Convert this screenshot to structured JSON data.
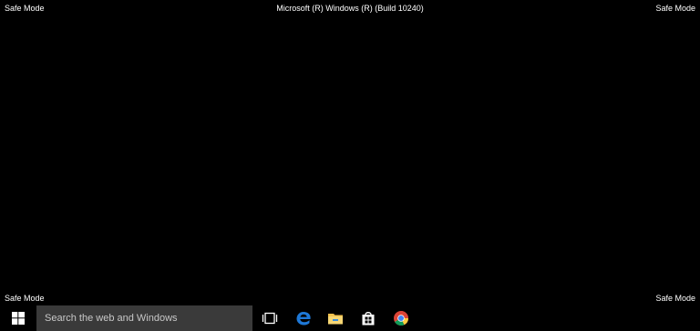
{
  "overlay": {
    "top_left": "Safe Mode",
    "top_right": "Safe Mode",
    "bottom_left": "Safe Mode",
    "bottom_right": "Safe Mode",
    "build_info": "Microsoft (R) Windows (R) (Build 10240)"
  },
  "taskbar": {
    "search_placeholder": "Search the web and Windows",
    "icons": [
      "windows-logo-icon",
      "task-view-icon",
      "edge-icon",
      "file-explorer-icon",
      "store-icon",
      "chrome-icon"
    ]
  },
  "colors": {
    "background": "#000000",
    "search_box": "#3a3a3a",
    "edge_blue": "#1e78d7",
    "explorer_yellow": "#f2c14e"
  }
}
